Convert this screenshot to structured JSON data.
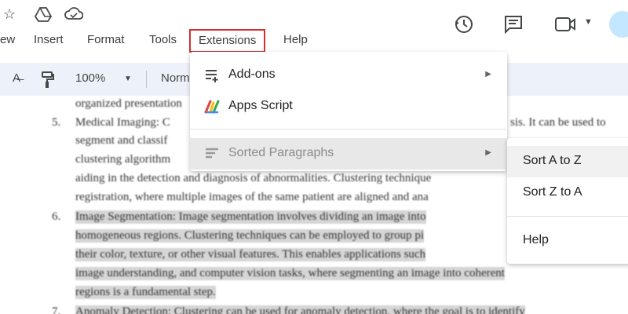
{
  "menubar": {
    "items": [
      "ew",
      "Insert",
      "Format",
      "Tools",
      "Extensions",
      "Help"
    ]
  },
  "toolbar": {
    "zoom": "100%",
    "style": "Norm"
  },
  "extensions_menu": {
    "items": [
      {
        "label": "Add-ons",
        "icon": "add-ons-icon",
        "has_submenu": true
      },
      {
        "label": "Apps Script",
        "icon": "apps-script-icon",
        "has_submenu": false
      },
      {
        "label": "Sorted Paragraphs",
        "icon": "sort-list-icon",
        "has_submenu": true
      }
    ]
  },
  "sorted_paragraphs_submenu": {
    "items": [
      "Sort A to Z",
      "Sort Z to A",
      "Help"
    ]
  },
  "document": {
    "numbers": [
      "5.",
      "6.",
      "7."
    ],
    "lines": [
      "organized presentation",
      "Medical Imaging: C",
      "segment and classif",
      "clustering algorithm",
      "aiding in the detection and diagnosis of abnormalities. Clustering technique",
      "registration, where multiple images of the same patient are aligned and ana",
      "Image Segmentation: Image segmentation involves dividing an image into",
      "homogeneous regions. Clustering techniques can be employed to group pi",
      "their color, texture, or other visual features. This enables applications such",
      "image understanding, and computer vision tasks, where segmenting an image into coherent",
      "regions is a fundamental step.",
      "Anomaly Detection: Clustering can be used for anomaly detection, where the goal is to identify"
    ],
    "right_fragment": "sis. It can be used to"
  },
  "colors": {
    "highlight_box": "#d32f2f",
    "toolbar_bg": "#edf2fa",
    "selection_bg": "#d6d6d6"
  }
}
